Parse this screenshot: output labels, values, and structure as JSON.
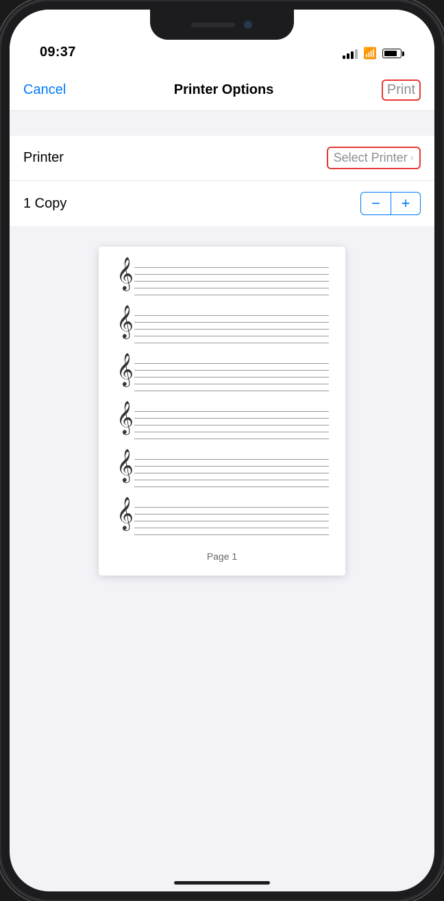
{
  "status": {
    "time": "09:37"
  },
  "nav": {
    "cancel_label": "Cancel",
    "title": "Printer Options",
    "print_label": "Print"
  },
  "form": {
    "printer_label": "Printer",
    "select_printer_text": "Select Printer",
    "copy_label": "1 Copy"
  },
  "preview": {
    "page_label": "Page 1"
  },
  "staves": [
    {
      "id": 1
    },
    {
      "id": 2
    },
    {
      "id": 3
    },
    {
      "id": 4
    },
    {
      "id": 5
    },
    {
      "id": 6
    }
  ]
}
